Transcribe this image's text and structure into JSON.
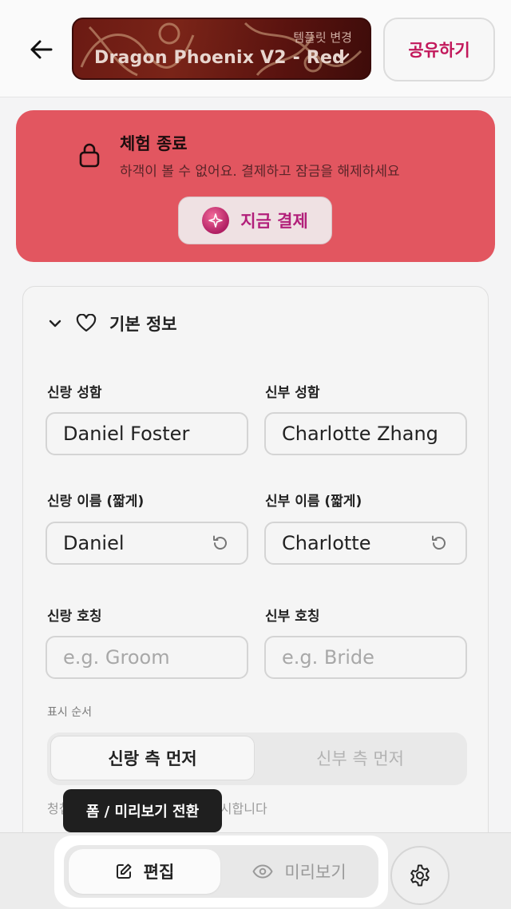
{
  "header": {
    "template_caption": "템플릿 변경",
    "template_name": "Dragon Phoenix V2 - Red",
    "share_label": "공유하기"
  },
  "trial": {
    "title": "체험 종료",
    "description": "하객이 볼 수 없어요. 결제하고 잠금을 해제하세요",
    "pay_label": "지금 결제",
    "accent": "#e25660"
  },
  "form": {
    "section_title": "기본 정보",
    "groom_name_label": "신랑 성함",
    "groom_name_value": "Daniel Foster",
    "bride_name_label": "신부 성함",
    "bride_name_value": "Charlotte Zhang",
    "groom_short_label": "신랑 이름 (짧게)",
    "groom_short_value": "Daniel",
    "bride_short_label": "신부 이름 (짧게)",
    "bride_short_value": "Charlotte",
    "groom_title_label": "신랑 호칭",
    "groom_title_placeholder": "e.g. Groom",
    "bride_title_label": "신부 호칭",
    "bride_title_placeholder": "e.g. Bride",
    "order_label": "표시 순서",
    "order_options": [
      "신랑 측 먼저",
      "신부 측 먼저"
    ],
    "order_selected": "신랑 측 먼저",
    "hint_text": "청첩장에 신랑 측 정보를 먼저 표시합니다"
  },
  "bottom": {
    "tooltip": "폼 / 미리보기 전환",
    "edit_label": "편집",
    "preview_label": "미리보기"
  }
}
